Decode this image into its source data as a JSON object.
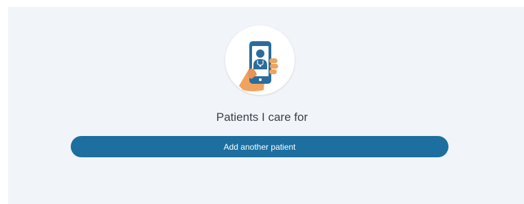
{
  "main": {
    "icon": "phone-in-hand-doctor-icon",
    "title": "Patients I care for",
    "add_button_label": "Add another patient"
  },
  "colors": {
    "panel_background": "#f1f4f8",
    "accent": "#1c6f9f",
    "hand": "#f0a35e",
    "phone": "#2a6d9c"
  }
}
